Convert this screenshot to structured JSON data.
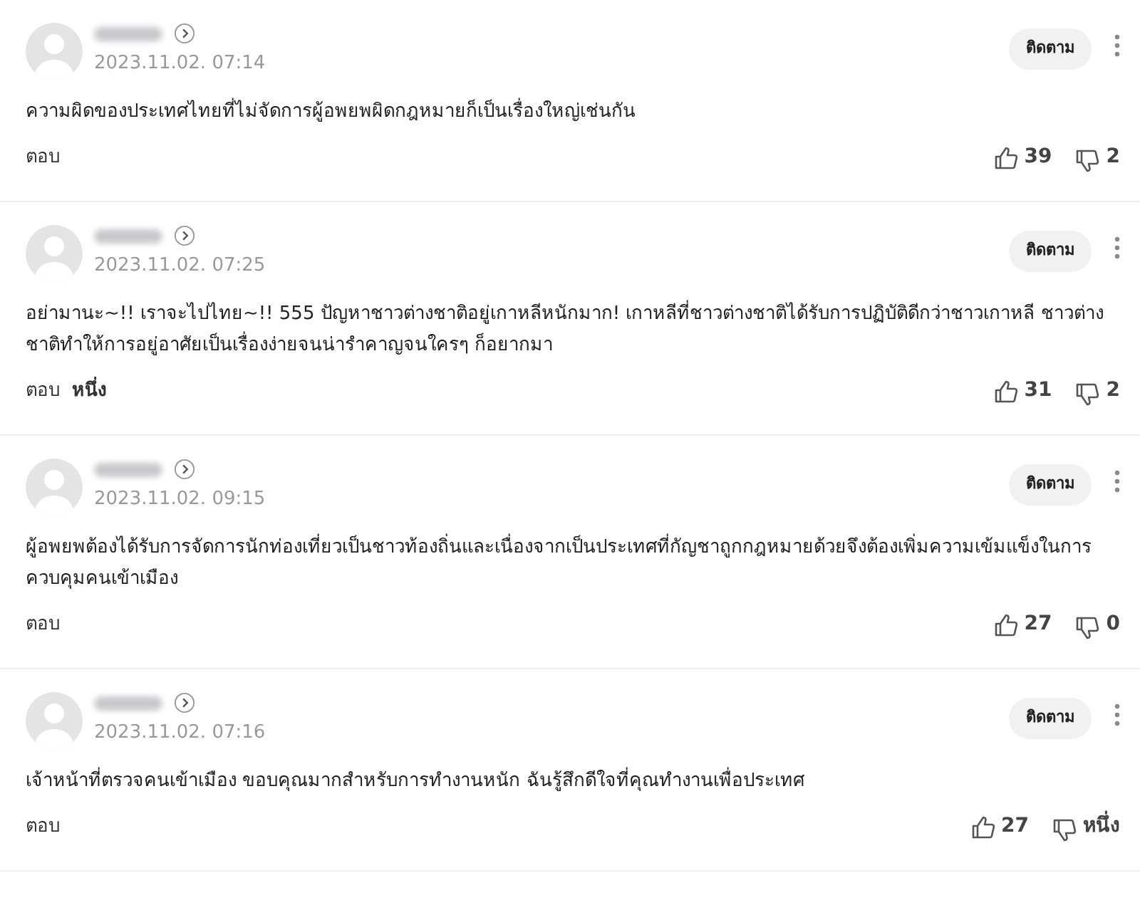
{
  "comments": [
    {
      "date": "2023.11.02. 07:14",
      "follow_label": "ติดตาม",
      "text": "ความผิดของประเทศไทยที่ไม่จัดการผู้อพยพผิดกฎหมายก็เป็นเรื่องใหญ่เช่นกัน",
      "reply_label": "ตอบ",
      "likes": "39",
      "dislikes": "2"
    },
    {
      "date": "2023.11.02. 07:25",
      "follow_label": "ติดตาม",
      "text": "อย่ามานะ~!! เราจะไปไทย~!! 555 ปัญหาชาวต่างชาติอยู่เกาหลีหนักมาก! เกาหลีที่ชาวต่างชาติได้รับการปฏิบัติดีกว่าชาวเกาหลี ชาวต่างชาติทำให้การอยู่อาศัยเป็นเรื่องง่ายจนน่ารำคาญจนใครๆ ก็อยากมา",
      "reply_label": "ตอบ",
      "reply_count": "หนึ่ง",
      "likes": "31",
      "dislikes": "2"
    },
    {
      "date": "2023.11.02. 09:15",
      "follow_label": "ติดตาม",
      "text": "ผู้อพยพต้องได้รับการจัดการนักท่องเที่ยวเป็นชาวท้องถิ่นและเนื่องจากเป็นประเทศที่กัญชาถูกกฎหมายด้วยจึงต้องเพิ่มความเข้มแข็งในการควบคุมคนเข้าเมือง",
      "reply_label": "ตอบ",
      "likes": "27",
      "dislikes": "0"
    },
    {
      "date": "2023.11.02. 07:16",
      "follow_label": "ติดตาม",
      "text": "เจ้าหน้าที่ตรวจคนเข้าเมือง ขอบคุณมากสำหรับการทำงานหนัก ฉันรู้สึกดีใจที่คุณทำงานเพื่อประเทศ",
      "reply_label": "ตอบ",
      "likes": "27",
      "dislikes": "หนึ่ง"
    }
  ]
}
